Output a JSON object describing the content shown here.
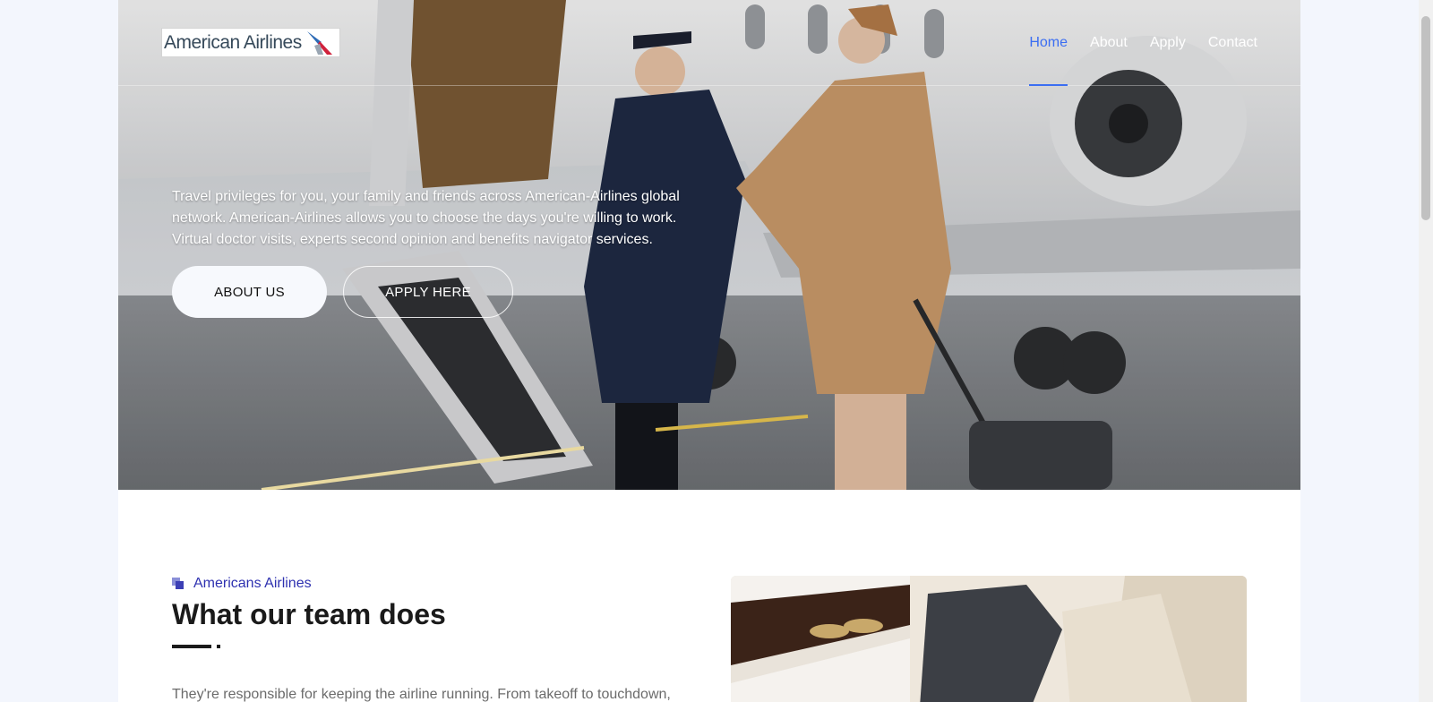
{
  "logo": {
    "text": "American Airlines",
    "mark": "american-airlines-flight-symbol"
  },
  "nav": {
    "items": [
      "Home",
      "About",
      "Apply",
      "Contact"
    ],
    "active": "Home",
    "active_color": "#3b6ef2"
  },
  "hero": {
    "text": "Travel privileges for you, your family and friends across American-Airlines global network. American-Airlines allows you to choose the days you're willing to work. Virtual doctor visits, experts second opinion and benefits navigator services.",
    "primary_button": "ABOUT US",
    "secondary_button": "APPLY HERE"
  },
  "section": {
    "eyebrow": "Americans Airlines",
    "eyebrow_color": "#2e31b0",
    "title": "What our team does",
    "body": "They're responsible for keeping the airline running. From takeoff to touchdown, our team members represent our shared commitment to service, excellence and"
  }
}
